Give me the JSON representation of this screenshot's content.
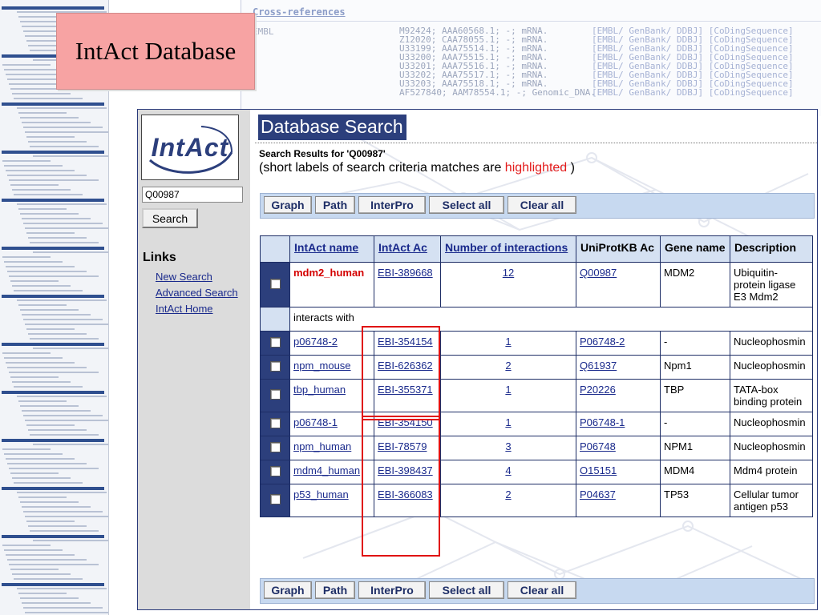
{
  "slide": {
    "title": "IntAct Database"
  },
  "xref": {
    "heading": "Cross-references",
    "db": "EMBL",
    "rows": [
      {
        "acc": "M92424; AAA60568.1; -; mRNA.",
        "links": "[EMBL/ GenBank/ DDBJ] [CoDingSequence]"
      },
      {
        "acc": "Z12020; CAA78055.1; -; mRNA.",
        "links": "[EMBL/ GenBank/ DDBJ] [CoDingSequence]"
      },
      {
        "acc": "U33199; AAA75514.1; -; mRNA.",
        "links": "[EMBL/ GenBank/ DDBJ] [CoDingSequence]"
      },
      {
        "acc": "U33200; AAA75515.1; -; mRNA.",
        "links": "[EMBL/ GenBank/ DDBJ] [CoDingSequence]"
      },
      {
        "acc": "U33201; AAA75516.1; -; mRNA.",
        "links": "[EMBL/ GenBank/ DDBJ] [CoDingSequence]"
      },
      {
        "acc": "U33202; AAA75517.1; -; mRNA.",
        "links": "[EMBL/ GenBank/ DDBJ] [CoDingSequence]"
      },
      {
        "acc": "U33203; AAA75518.1; -; mRNA.",
        "links": "[EMBL/ GenBank/ DDBJ] [CoDingSequence]"
      },
      {
        "acc": "AF527840; AAM78554.1; -; Genomic_DNA.",
        "links": "[EMBL/ GenBank/ DDBJ] [CoDingSequence]"
      }
    ]
  },
  "sidebar": {
    "logo": "IntAct",
    "search_value": "Q00987",
    "search_button": "Search",
    "links_title": "Links",
    "links": [
      "New Search",
      "Advanced Search",
      "IntAct Home"
    ]
  },
  "page": {
    "title": "Database Search",
    "results_label": "Search Results for 'Q00987'",
    "note_prefix": "(short labels of search criteria matches are ",
    "note_highlight": "highlighted",
    "note_suffix": " )"
  },
  "toolbar": {
    "buttons": [
      "Graph",
      "Path",
      "InterPro",
      "Select all",
      "Clear all"
    ]
  },
  "table": {
    "headers": [
      "IntAct name",
      "IntAct Ac",
      "Number of interactions",
      "UniProtKB Ac",
      "Gene name",
      "Description"
    ],
    "query_row": {
      "name": "mdm2_human",
      "ac": "EBI-389668",
      "count": "12",
      "uniprot": "Q00987",
      "gene": "MDM2",
      "desc": "Ubiquitin-protein ligase E3 Mdm2"
    },
    "interacts_label": "interacts with",
    "rows": [
      {
        "name": "p06748-2",
        "ac": "EBI-354154",
        "count": "1",
        "uniprot": "P06748-2",
        "gene": "-",
        "desc": "Nucleophosmin"
      },
      {
        "name": "npm_mouse",
        "ac": "EBI-626362",
        "count": "2",
        "uniprot": "Q61937",
        "gene": "Npm1",
        "desc": "Nucleophosmin"
      },
      {
        "name": "tbp_human",
        "ac": "EBI-355371",
        "count": "1",
        "uniprot": "P20226",
        "gene": "TBP",
        "desc": "TATA-box binding protein"
      },
      {
        "name": "p06748-1",
        "ac": "EBI-354150",
        "count": "1",
        "uniprot": "P06748-1",
        "gene": "-",
        "desc": "Nucleophosmin"
      },
      {
        "name": "npm_human",
        "ac": "EBI-78579",
        "count": "3",
        "uniprot": "P06748",
        "gene": "NPM1",
        "desc": "Nucleophosmin"
      },
      {
        "name": "mdm4_human",
        "ac": "EBI-398437",
        "count": "4",
        "uniprot": "O15151",
        "gene": "MDM4",
        "desc": "Mdm4 protein"
      },
      {
        "name": "p53_human",
        "ac": "EBI-366083",
        "count": "2",
        "uniprot": "P04637",
        "gene": "TP53",
        "desc": "Cellular tumor antigen p53"
      }
    ]
  },
  "colors": {
    "header_navy": "#2c3f7c",
    "highlight_red": "#e31b1b",
    "toolbar_blue": "#c7d9f0",
    "title_box_pink": "#f7a3a3"
  }
}
